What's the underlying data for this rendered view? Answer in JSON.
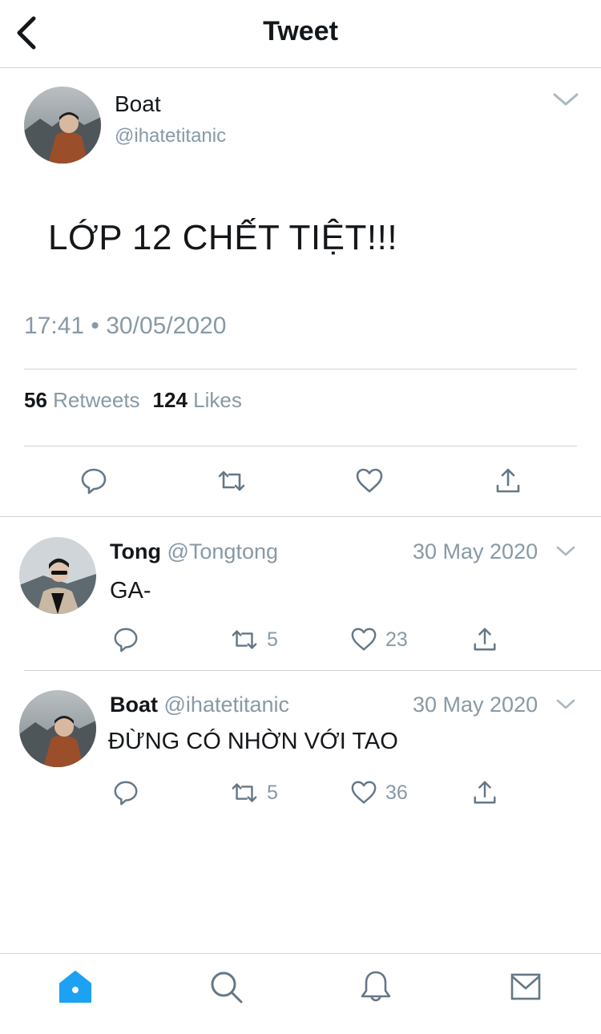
{
  "header": {
    "title": "Tweet"
  },
  "main_tweet": {
    "name": "Boat",
    "handle": "@ihatetitanic",
    "text": "LỚP 12 CHẾT TIỆT!!!",
    "timestamp": "17:41 • 30/05/2020",
    "retweet_count": "56",
    "retweets_label": "Retweets",
    "like_count": "124",
    "likes_label": "Likes"
  },
  "replies": [
    {
      "name": "Tong",
      "handle": "@Tongtong",
      "date": "30 May 2020",
      "text": "GA-",
      "retweets": "5",
      "likes": "23"
    },
    {
      "name": "Boat",
      "handle": "@ihatetitanic",
      "date": "30 May 2020",
      "text": "ĐỪNG CÓ NHỜN VỚI TAO",
      "retweets": "5",
      "likes": "36"
    }
  ],
  "tabbar": {
    "items": [
      "home-icon",
      "search-icon",
      "bell-icon",
      "mail-icon"
    ],
    "active": "home-icon"
  },
  "colors": {
    "text": "#14171a",
    "muted": "#8899a6",
    "icon": "#657786",
    "accent": "#1da1f2",
    "divider": "#cfd3d6"
  }
}
